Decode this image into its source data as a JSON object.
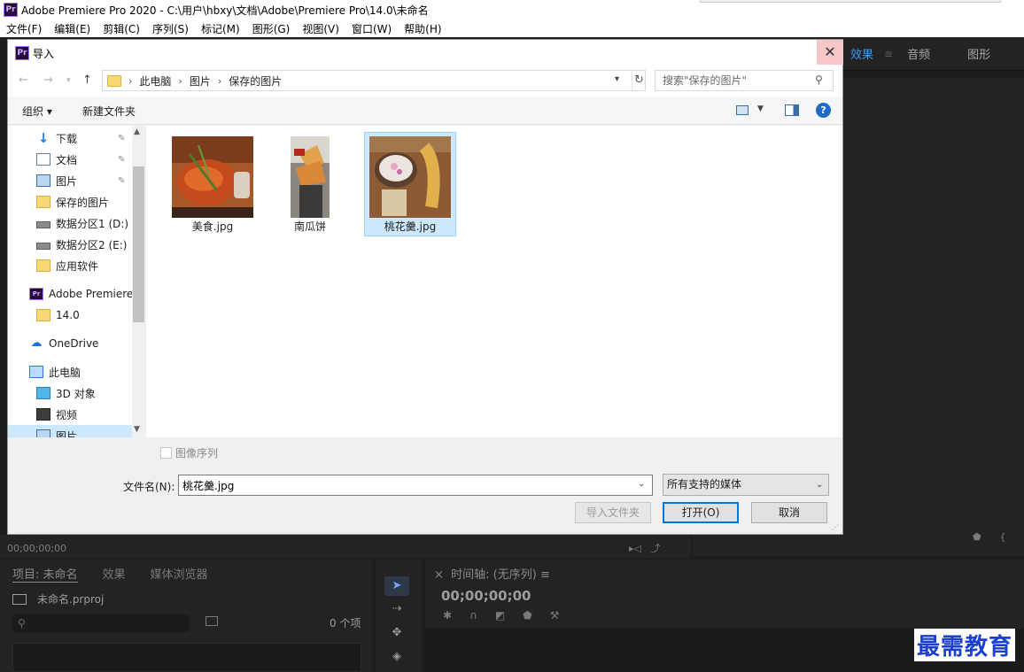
{
  "app": {
    "title": "Adobe Premiere Pro 2020 - C:\\用户\\hbxy\\文档\\Adobe\\Premiere Pro\\14.0\\未命名",
    "logo_text": "Pr",
    "menu": [
      "文件(F)",
      "编辑(E)",
      "剪辑(C)",
      "序列(S)",
      "标记(M)",
      "图形(G)",
      "视图(V)",
      "窗口(W)",
      "帮助(H)"
    ],
    "right_tabs": {
      "effects": "效果",
      "audio": "音频",
      "graphics": "图形"
    },
    "monitor_timecode": "00;00;00;00",
    "project_tabs": {
      "project": "项目: 未命名",
      "effects": "效果",
      "media_browser": "媒体浏览器"
    },
    "project_file": "未命名.prproj",
    "project_count": "0 个项",
    "timeline_title": "时间轴: (无序列)",
    "timeline_timecode": "00;00;00;00",
    "watermark": "最需教育"
  },
  "dialog": {
    "title": "导入",
    "breadcrumb": [
      "此电脑",
      "图片",
      "保存的图片"
    ],
    "search_placeholder": "搜索\"保存的图片\"",
    "toolbar": {
      "organize": "组织 ▾",
      "new_folder": "新建文件夹"
    },
    "nav_items": [
      {
        "label": "下载",
        "icon": "download-icon",
        "pinned": true
      },
      {
        "label": "文档",
        "icon": "document-icon",
        "pinned": true
      },
      {
        "label": "图片",
        "icon": "pictures-icon",
        "pinned": true
      },
      {
        "label": "保存的图片",
        "icon": "folder-icon",
        "pinned": false
      },
      {
        "label": "数据分区1 (D:)",
        "icon": "drive-icon",
        "pinned": false
      },
      {
        "label": "数据分区2 (E:)",
        "icon": "drive-icon",
        "pinned": false
      },
      {
        "label": "应用软件",
        "icon": "folder-icon",
        "pinned": false
      },
      {
        "label": "Adobe Premiere",
        "icon": "premiere-icon",
        "pinned": false
      },
      {
        "label": "14.0",
        "icon": "folder-icon",
        "pinned": false
      },
      {
        "label": "OneDrive",
        "icon": "onedrive-icon",
        "pinned": false
      },
      {
        "label": "此电脑",
        "icon": "computer-icon",
        "pinned": false
      },
      {
        "label": "3D 对象",
        "icon": "3d-objects-icon",
        "pinned": false
      },
      {
        "label": "视频",
        "icon": "video-icon",
        "pinned": false
      },
      {
        "label": "图片",
        "icon": "pictures-icon",
        "pinned": false,
        "selected": true
      }
    ],
    "files": [
      {
        "name": "美食.jpg",
        "selected": false
      },
      {
        "name": "南瓜饼",
        "selected": false
      },
      {
        "name": "桃花羹.jpg",
        "selected": true
      }
    ],
    "image_sequence_label": "图像序列",
    "filename_label": "文件名(N):",
    "filename_value": "桃花羹.jpg",
    "filetype_value": "所有支持的媒体",
    "buttons": {
      "import_folder": "导入文件夹",
      "open": "打开(O)",
      "cancel": "取消"
    }
  }
}
